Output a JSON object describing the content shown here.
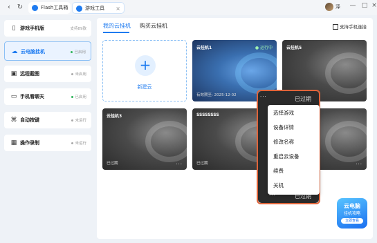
{
  "tabs": [
    {
      "label": "Flash工具箱",
      "icon": "flash-icon",
      "color": "#1e7bf0"
    },
    {
      "label": "游戏工具",
      "icon": "game-tool-icon",
      "color": "#1e7bf0"
    }
  ],
  "user": {
    "name": "泽"
  },
  "sidebar": {
    "items": [
      {
        "label": "游戏手机版",
        "status": "支持89款",
        "icon": "game-phone-icon"
      },
      {
        "label": "云电脑挂机",
        "status": "已启用",
        "icon": "cloud-pc-icon",
        "status_color": "#2fb45a"
      },
      {
        "label": "远程截图",
        "status": "未启用",
        "icon": "screenshot-icon",
        "status_color": "#aaaaaa"
      },
      {
        "label": "手机看聊天",
        "status": "已启用",
        "icon": "phone-chat-icon",
        "status_color": "#2fb45a"
      },
      {
        "label": "自动按键",
        "status": "未运行",
        "icon": "auto-key-icon",
        "status_color": "#aaaaaa"
      },
      {
        "label": "操作录制",
        "status": "未运行",
        "icon": "record-icon",
        "status_color": "#aaaaaa"
      }
    ]
  },
  "main": {
    "tabs": [
      "我的云挂机",
      "购买云挂机"
    ],
    "phone_link": "支持手机连接",
    "new_label": "新建云",
    "cards": [
      {
        "name": "云挂机1",
        "running": "运行中",
        "footer": "有效期至: 2025-12-02",
        "more": "···"
      },
      {
        "name": "云挂机5",
        "footer": "",
        "more": ""
      },
      {
        "name": "云挂机3",
        "footer": "已过期",
        "more": "···"
      },
      {
        "name": "SSSSSSSS",
        "footer": "已过期",
        "more": "···"
      },
      {
        "name": "",
        "footer": "",
        "more": "···"
      }
    ],
    "highlight_expired": "已过期",
    "menu": [
      "选择游戏",
      "设备详情",
      "修改名称",
      "重启云设备",
      "续费",
      "关机"
    ]
  },
  "badge": {
    "line1": "云电脑",
    "line2": "挂机攻略",
    "line3": "立即查看"
  },
  "colors": {
    "accent": "#1e7bf0",
    "highlight": "#e0643a",
    "running": "#9ef0b0"
  }
}
